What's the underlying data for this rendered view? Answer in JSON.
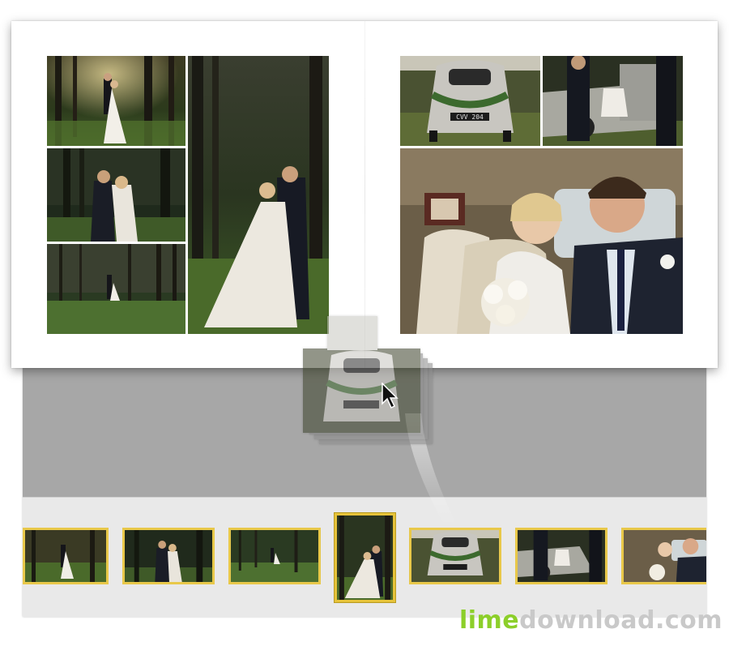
{
  "album": {
    "left_page_photos": [
      "forest couple embrace",
      "forest couple close",
      "forest couple walking",
      "forest couple portrait"
    ],
    "right_page_photos": [
      "vintage car rear",
      "car door",
      "couple in car"
    ]
  },
  "plates": {
    "car_plate": "CVV 204"
  },
  "filmstrip": {
    "thumbnails": [
      "forest-1",
      "forest-2",
      "forest-3",
      "forest-portrait",
      "car-rear",
      "car-door",
      "couple-car"
    ],
    "selected_index": 3
  },
  "watermark": {
    "part1": "lime",
    "part2": "download.com"
  },
  "colors": {
    "accent_border": "#e8c84a",
    "workspace_bg": "#a7a7a7",
    "filmstrip_bg": "#e9e9e9"
  }
}
